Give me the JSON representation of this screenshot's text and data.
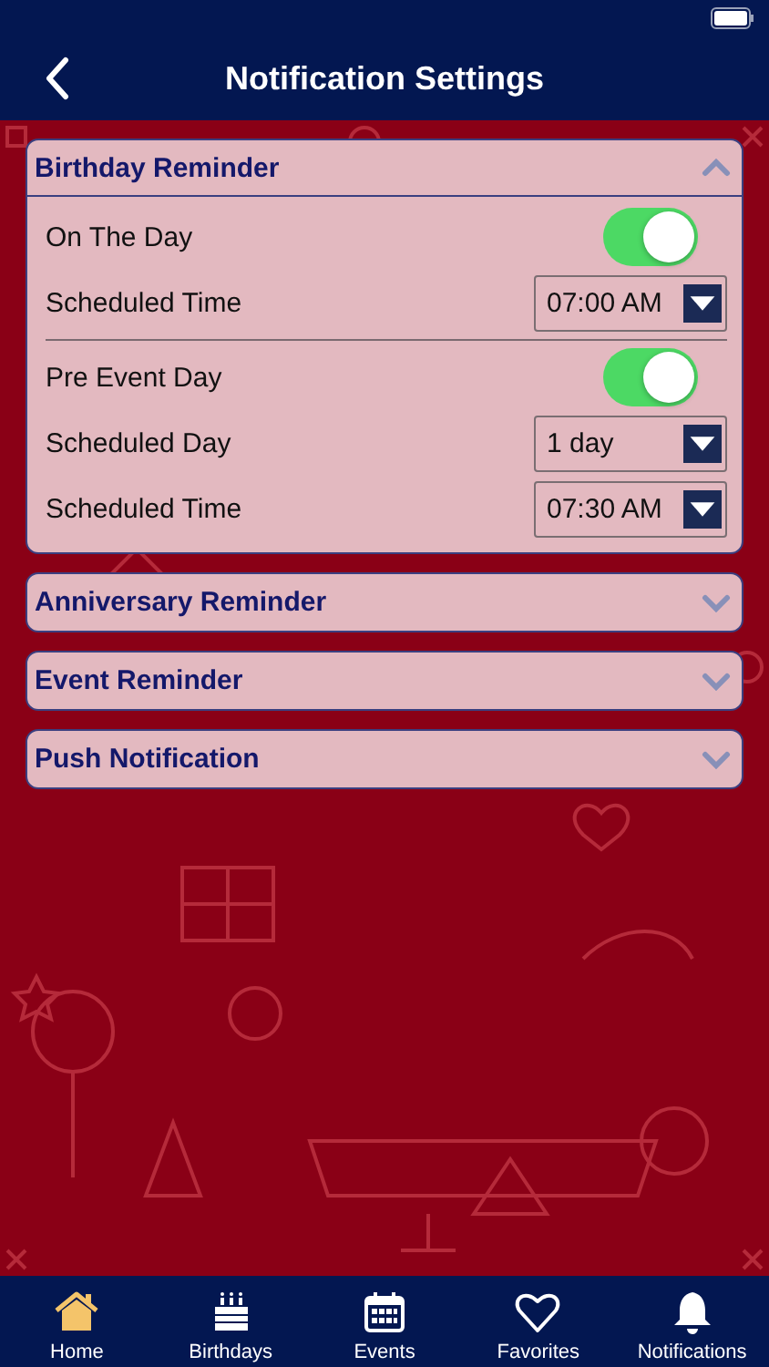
{
  "header": {
    "title": "Notification Settings"
  },
  "sections": [
    {
      "title": "Birthday Reminder",
      "expanded": true,
      "groups": [
        [
          {
            "kind": "toggle",
            "label": "On The Day",
            "on": true
          },
          {
            "kind": "dropdown",
            "label": "Scheduled Time",
            "value": "07:00 AM"
          }
        ],
        [
          {
            "kind": "toggle",
            "label": "Pre Event Day",
            "on": true
          },
          {
            "kind": "dropdown",
            "label": "Scheduled Day",
            "value": "1 day"
          },
          {
            "kind": "dropdown",
            "label": "Scheduled Time",
            "value": "07:30 AM"
          }
        ]
      ]
    },
    {
      "title": "Anniversary Reminder",
      "expanded": false
    },
    {
      "title": "Event Reminder",
      "expanded": false
    },
    {
      "title": "Push Notification",
      "expanded": false
    }
  ],
  "tabs": [
    {
      "label": "Home",
      "selected": true
    },
    {
      "label": "Birthdays",
      "selected": false
    },
    {
      "label": "Events",
      "selected": false
    },
    {
      "label": "Favorites",
      "selected": false
    },
    {
      "label": "Notifications",
      "selected": false
    }
  ]
}
